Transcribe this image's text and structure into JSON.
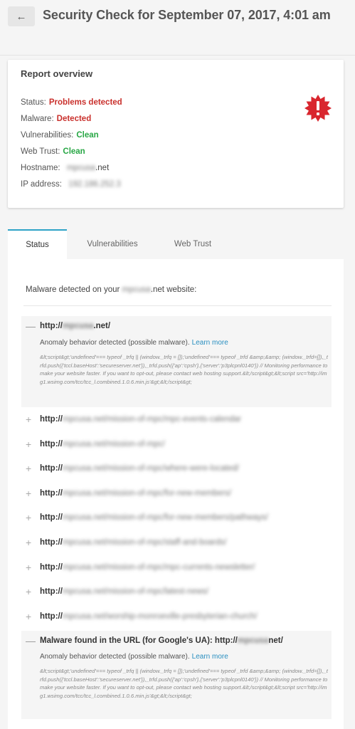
{
  "header": {
    "back_glyph": "←",
    "title": "Security Check for September 07, 2017, 4:01 am"
  },
  "report": {
    "title": "Report overview",
    "status_label": "Status:",
    "status_value": "Problems detected",
    "malware_label": "Malware:",
    "malware_value": "Detected",
    "vuln_label": "Vulnerabilities:",
    "vuln_value": "Clean",
    "webtrust_label": "Web Trust:",
    "webtrust_value": "Clean",
    "hostname_label": "Hostname:",
    "hostname_blur": "mpcusa",
    "hostname_tld": ".net",
    "ip_label": "IP address:",
    "ip_blur": "192.186.252.3",
    "badge_icon": "alert-burst-icon",
    "badge_color": "#d9262e"
  },
  "tabs": [
    "Status",
    "Vulnerabilities",
    "Web Trust"
  ],
  "status_panel": {
    "intro_prefix": "Malware detected on your",
    "intro_blur": "mpcusa",
    "intro_suffix": ".net website:",
    "first": {
      "url_prefix": "http://",
      "url_blur": "mpcusa",
      "url_suffix": ".net/",
      "description": "Anomaly behavior detected (possible malware).",
      "learn_more": "Learn more",
      "code": "&lt;script&gt;'undefined'=== typeof _trfq || (window._trfq = []);'undefined'=== typeof _trfd &amp;&amp; (window._trfd=[]),_trfd.push({'tccl.baseHost':'secureserver.net'}),_trfd.push({'ap':'cpsh'},{'server':'p3plcpnl0140'}) // Monitoring performance to make your website faster. If you want to opt-out, please contact web hosting support.&lt;/script&gt;&lt;script src='http://img1.wsimg.com/tcc/tcc_l.combined.1.0.6.min.js'&gt;&lt;/script&gt;"
    },
    "url_prefix": "http://",
    "urls": [
      "mpcusa.net/mission-of-mpc/mpc-events-calendar",
      "mpcusa.net/mission-of-mpc/",
      "mpcusa.net/mission-of-mpc/where-were-located/",
      "mpcusa.net/mission-of-mpc/for-new-members/",
      "mpcusa.net/mission-of-mpc/for-new-members/pathways/",
      "mpcusa.net/mission-of-mpc/staff-and-boards/",
      "mpcusa.net/mission-of-mpc/mpc-currents-newsletter/",
      "mpcusa.net/mission-of-mpc/latest-news/",
      "mpcusa.net/worship-monroeville-presbyterian-church/"
    ],
    "google": {
      "label_prefix": "Malware found in the URL (for Google's UA): http://",
      "url_blur": "mpcusa",
      "url_suffix": "net/",
      "description": "Anomaly behavior detected (possible malware).",
      "learn_more": "Learn more",
      "code": "&lt;script&gt;'undefined'=== typeof _trfq || (window._trfq = []);'undefined'=== typeof _trfd &amp;&amp; (window._trfd=[]),_trfd.push({'tccl.baseHost':'secureserver.net'}),_trfd.push({'ap':'cpsh'},{'server':'p3plcpnl0140'}) // Monitoring performance to make your website faster. If you want to opt-out, please contact web hosting support.&lt;/script&gt;&lt;script src='http://img1.wsimg.com/tcc/tcc_l.combined.1.0.6.min.js'&gt;&lt;/script&gt;"
    }
  }
}
